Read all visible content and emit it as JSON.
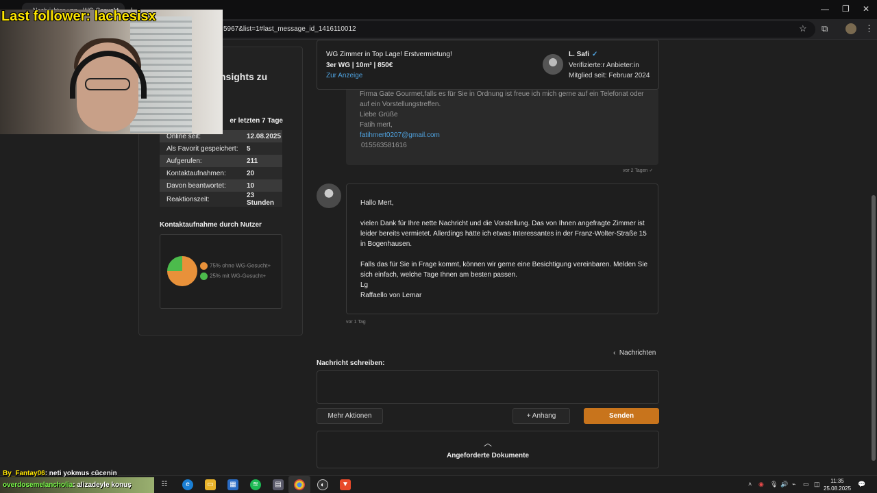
{
  "browser": {
    "tab_title": "Nachrichten von - WG-Gesucht",
    "tab_close": "✕",
    "url_fragment": "5967&list=1#last_message_id_1416110012"
  },
  "overlay": {
    "last_follower": "Last follower: lachesisx",
    "chat_line1_user": "By_Fantay06",
    "chat_line1_text": ": neti yokmus cücenin",
    "chat_line2_user": "overdosemelancholia",
    "chat_line2_text": ": alizadeyle konuş"
  },
  "left_panel": {
    "heading_partial": "nsights zu",
    "stats_title": "er letzten 7 Tage",
    "stats": [
      {
        "label": "Online seit:",
        "value": "12.08.2025"
      },
      {
        "label": "Als Favorit gespeichert:",
        "value": "5"
      },
      {
        "label": "Aufgerufen:",
        "value": "211"
      },
      {
        "label": "Kontaktaufnahmen:",
        "value": "20"
      },
      {
        "label": "Davon beantwortet:",
        "value": "10"
      },
      {
        "label": "Reaktionszeit:",
        "value": "23 Stunden"
      }
    ],
    "contact_title": "Kontaktaufnahme durch Nutzer",
    "legend": [
      {
        "label": "75% ohne WG-Gesucht+",
        "color": "#e8913a"
      },
      {
        "label": "25% mit WG-Gesucht+",
        "color": "#4cbb4c"
      }
    ]
  },
  "chart_data": {
    "type": "pie",
    "categories": [
      "ohne WG-Gesucht+",
      "mit WG-Gesucht+"
    ],
    "values": [
      75,
      25
    ],
    "colors": [
      "#e8913a",
      "#4cbb4c"
    ]
  },
  "listing": {
    "title": "WG Zimmer in Top Lage! Erstvermietung!",
    "details": "3er WG | 10m² | 850€",
    "link": "Zur Anzeige",
    "seller_name": "L. Safi",
    "seller_status": "Verifizierte:r Anbieter:in",
    "member_since": "Mitglied seit: Februar 2024"
  },
  "messages": {
    "msg1_lines": [
      "Firma Gate Gourmet,falls es für Sie in Ordnung ist freue ich mich gerne auf ein Telefonat oder",
      "auf ein Vorstellungstreffen.",
      "Liebe Grüße",
      "Fatih mert,"
    ],
    "msg1_email": "fatihmert0207@gmail.com",
    "msg1_phone": "015563581616",
    "msg1_time": "vor 2 Tagen",
    "msg2_lines": [
      "Hallo Mert,",
      "vielen Dank für Ihre nette Nachricht und die Vorstellung. Das von Ihnen angefragte Zimmer ist",
      "leider bereits vermietet. Allerdings hätte ich etwas Interessantes in der Franz-Wolter-Straße 15",
      "in Bogenhausen.",
      "Falls das für Sie in Frage kommt, können wir gerne eine Besichtigung vereinbaren. Melden Sie",
      "sich einfach, welche Tage Ihnen am besten passen.",
      "Lg",
      "Raffaello von Lemar"
    ],
    "msg2_time": "vor 1 Tag"
  },
  "compose": {
    "back_link": "Nachrichten",
    "label": "Nachricht schreiben:",
    "placeholder": "",
    "more_actions": "Mehr Aktionen",
    "attachment": "Anhang",
    "send": "Senden",
    "requested_docs": "Angeforderte Dokumente"
  },
  "taskbar": {
    "time": "11:35",
    "date": "25.08.2025"
  }
}
